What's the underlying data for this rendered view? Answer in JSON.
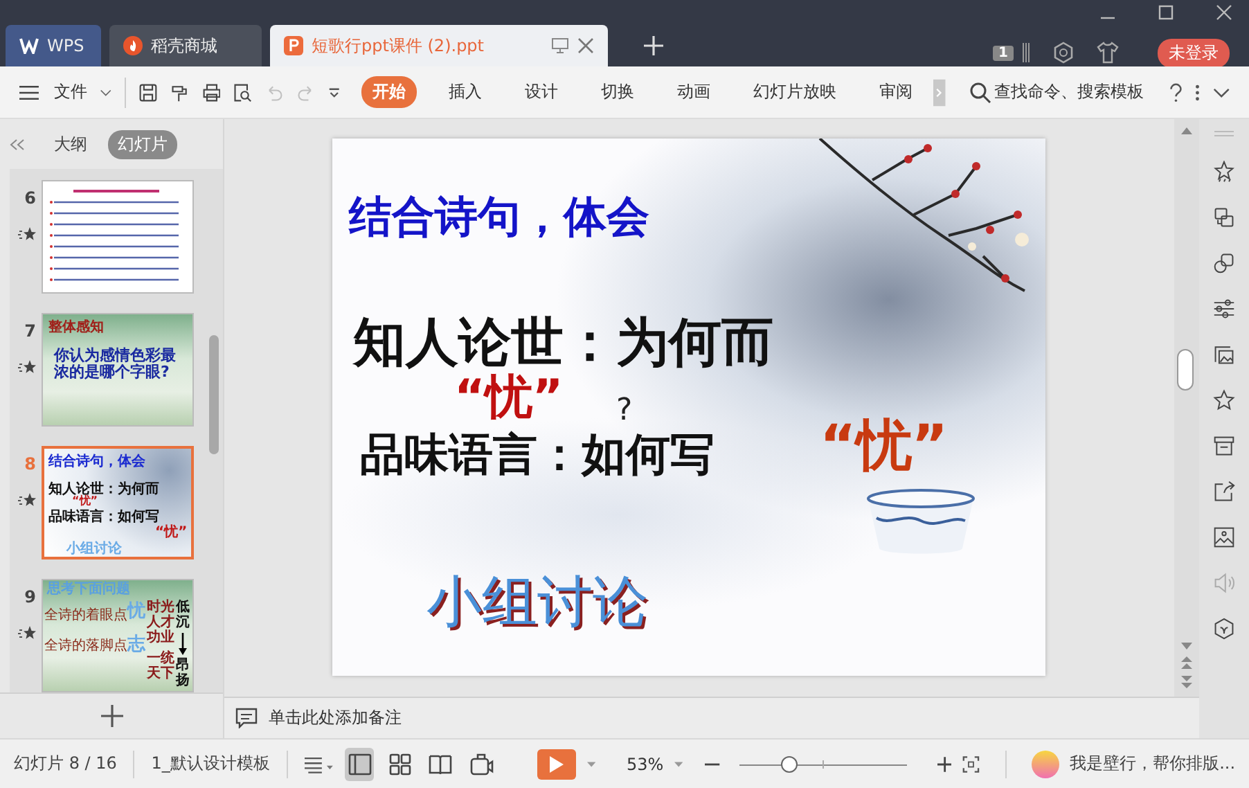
{
  "window": {
    "tabs": [
      {
        "label": "WPS",
        "kind": "home",
        "selected": false
      },
      {
        "label": "稻壳商城",
        "kind": "store",
        "selected": false
      },
      {
        "label": "短歌行ppt课件 (2).ppt",
        "kind": "document",
        "selected": true
      }
    ],
    "badge": "1",
    "login": "未登录"
  },
  "toolbar": {
    "file_menu": "文件",
    "quick_access": [
      {
        "kind": "save",
        "disabled": false
      },
      {
        "kind": "painter",
        "disabled": false
      },
      {
        "kind": "print",
        "disabled": false
      },
      {
        "kind": "preview",
        "disabled": false
      },
      {
        "kind": "undo",
        "disabled": true
      },
      {
        "kind": "redo",
        "disabled": true
      }
    ],
    "ribbon_tabs": [
      {
        "label": "开始",
        "selected": true
      },
      {
        "label": "插入",
        "selected": false
      },
      {
        "label": "设计",
        "selected": false
      },
      {
        "label": "切换",
        "selected": false
      },
      {
        "label": "动画",
        "selected": false
      },
      {
        "label": "幻灯片放映",
        "selected": false
      },
      {
        "label": "审阅",
        "selected": false
      }
    ],
    "search": "查找命令、搜索模板"
  },
  "slide_panel": {
    "tabs": [
      {
        "label": "大纲",
        "selected": false
      },
      {
        "label": "幻灯片",
        "selected": true
      }
    ],
    "slides": [
      {
        "number": "6",
        "kind": "lines",
        "selected": false
      },
      {
        "number": "7",
        "kind": "question",
        "selected": false,
        "heading": "整体感知",
        "body": "你认为感情色彩最浓的是哪个字眼?"
      },
      {
        "number": "8",
        "kind": "current",
        "selected": true,
        "texts": [
          "结合诗句，体会",
          "知人论世：为何而",
          "“忧”",
          "品味语言：如何写",
          "“忧”",
          "小组讨论"
        ]
      },
      {
        "number": "9",
        "kind": "contrast",
        "selected": false,
        "heading": "思考下面问题",
        "texts": [
          "全诗的着眼点",
          "全诗的落脚点",
          "忧",
          "志",
          "时光人才功业",
          "一统天下",
          "低沉",
          "昂扬"
        ]
      }
    ]
  },
  "slide": {
    "title": "结合诗句，体会",
    "line_1": "知人论世：为何而",
    "mark_1": "“忧”",
    "question": "?",
    "line_2": "品味语言：如何写",
    "mark_2": "“忧”",
    "footer": "小组讨论"
  },
  "notes": "单击此处添加备注",
  "status_bar": {
    "slide_counter": "幻灯片 8 / 16",
    "template": "1_默认设计模板",
    "views": [
      {
        "kind": "normal",
        "selected": true
      },
      {
        "kind": "sorter",
        "selected": false
      },
      {
        "kind": "reading",
        "selected": false
      },
      {
        "kind": "presenter",
        "selected": false
      }
    ],
    "zoom": "53%",
    "zoom_slider": {
      "level": 0.3
    },
    "assistant": "我是壁行，帮你排版..."
  }
}
